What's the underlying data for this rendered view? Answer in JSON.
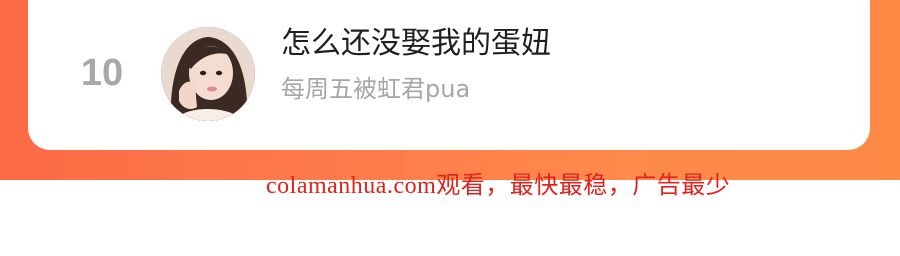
{
  "list_item": {
    "rank": "10",
    "title": "怎么还没娶我的蛋妞",
    "author": "每周五被虹君pua"
  },
  "watermark": "colamanhua.com观看，最快最稳，广告最少",
  "colors": {
    "accent_band": "#fd7a4a",
    "watermark": "#e0231c",
    "rank": "#a8a8a8",
    "title": "#1f1f1f",
    "author": "#a6a6a6"
  }
}
